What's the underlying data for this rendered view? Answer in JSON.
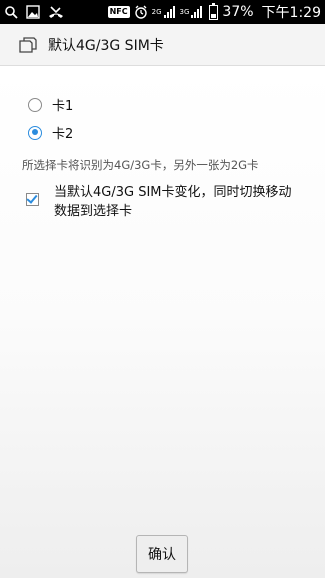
{
  "status_bar": {
    "icons_left": [
      "search-icon",
      "image-icon",
      "missed-call-icon"
    ],
    "nfc_label": "NFC",
    "net1_label": "2G",
    "net2_label": "3G",
    "battery_percent": "37%",
    "battery_level": 0.37,
    "time": "下午1:29"
  },
  "header": {
    "title": "默认4G/3G SIM卡"
  },
  "options": [
    {
      "label": "卡1",
      "checked": false
    },
    {
      "label": "卡2",
      "checked": true
    }
  ],
  "note": "所选择卡将识别为4G/3G卡，另外一张为2G卡",
  "switch_checkbox": {
    "label": "当默认4G/3G SIM卡变化，同时切换移动数据到选择卡",
    "checked": true
  },
  "confirm_label": "确认",
  "colors": {
    "accent": "#2b8cde",
    "status_bar_bg": "#000000",
    "header_bg": "#f4f4f4"
  }
}
